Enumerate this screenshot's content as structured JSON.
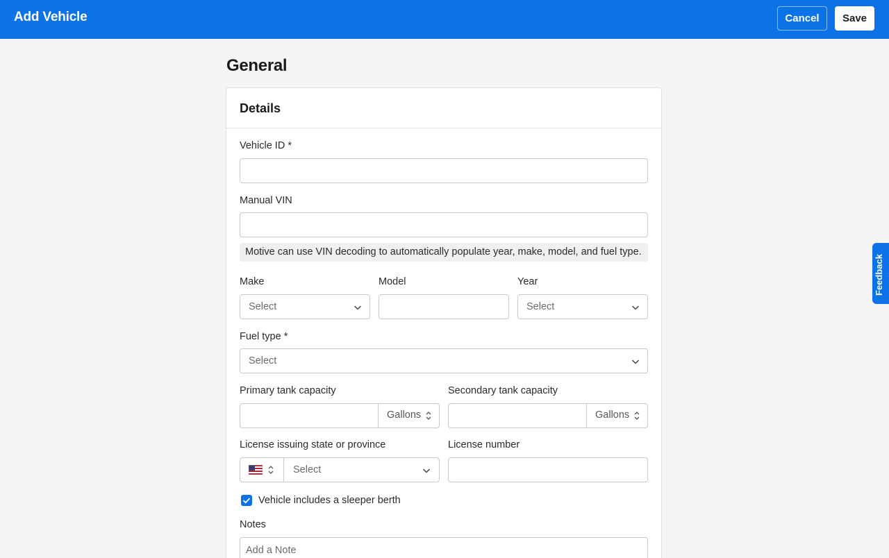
{
  "header": {
    "title": "Add Vehicle",
    "cancel_label": "Cancel",
    "save_label": "Save"
  },
  "page": {
    "section_title": "General"
  },
  "details": {
    "title": "Details",
    "vehicle_id": {
      "label": "Vehicle ID",
      "required_mark": "*",
      "value": ""
    },
    "manual_vin": {
      "label": "Manual VIN",
      "value": "",
      "hint": "Motive can use VIN decoding to automatically populate year, make, model, and fuel type."
    },
    "make": {
      "label": "Make",
      "placeholder": "Select"
    },
    "model": {
      "label": "Model",
      "value": ""
    },
    "year": {
      "label": "Year",
      "placeholder": "Select"
    },
    "fuel_type": {
      "label": "Fuel type",
      "required_mark": "*",
      "placeholder": "Select"
    },
    "primary_tank": {
      "label": "Primary tank capacity",
      "value": "",
      "unit": "Gallons"
    },
    "secondary_tank": {
      "label": "Secondary tank capacity",
      "value": "",
      "unit": "Gallons"
    },
    "license_state": {
      "label": "License issuing state or province",
      "country_icon": "us-flag-icon",
      "placeholder": "Select"
    },
    "license_number": {
      "label": "License number",
      "value": ""
    },
    "sleeper_berth": {
      "label": "Vehicle includes a sleeper berth",
      "checked": true
    },
    "notes": {
      "label": "Notes",
      "placeholder": "Add a Note"
    }
  },
  "feedback": {
    "label": "Feedback"
  },
  "colors": {
    "primary": "#0b72e7",
    "background": "#f5f5f5"
  }
}
